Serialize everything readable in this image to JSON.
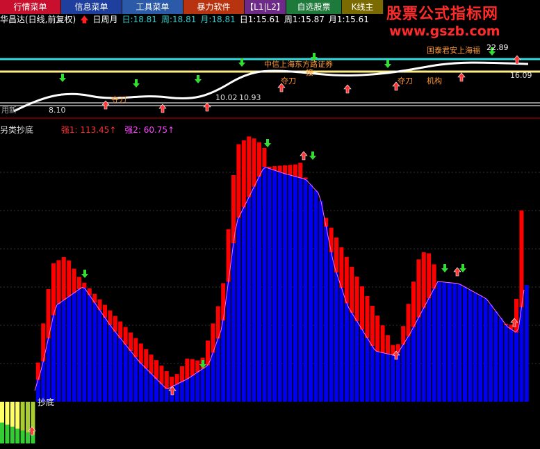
{
  "menu": [
    "行情菜单",
    "信息菜单",
    "工具菜单",
    "暴力软件",
    "【L1|L2】",
    "自选股票",
    "K线主"
  ],
  "brand": {
    "title": "股票公式指标网",
    "url": "www.gszb.com"
  },
  "info": {
    "stock": "华昌达(日线,前复权)",
    "period": "日周月",
    "ri": "日:18.81",
    "zhou": "周:18.81",
    "yue": "月:18.81",
    "r1": "日1:15.61",
    "z1": "周1:15.87",
    "y1": "月1:15.61"
  },
  "price_labels": {
    "zhongxin": "中信上海东方路证券",
    "guotai": "国泰君安上海福",
    "top_value": "22.89",
    "dadao1": "夺刀",
    "dadao2": "夺刀",
    "dadao3": "夺刀",
    "jigou": "机构",
    "v1": "10.02",
    "v2": "10.93",
    "v3": "8.10",
    "v4": "16.09",
    "left_tag": "用新",
    "left_tag2": "接"
  },
  "indicator": {
    "name": "另类抄底",
    "strong1": "强1: 113.45",
    "strong2": "强2: 60.75",
    "bottom_label": "抄底"
  },
  "colors": {
    "up": "#ff0000",
    "blue": "#0000ee",
    "yellow": "#ffff66",
    "green": "#33cc33",
    "cyan": "#33cccc"
  }
}
